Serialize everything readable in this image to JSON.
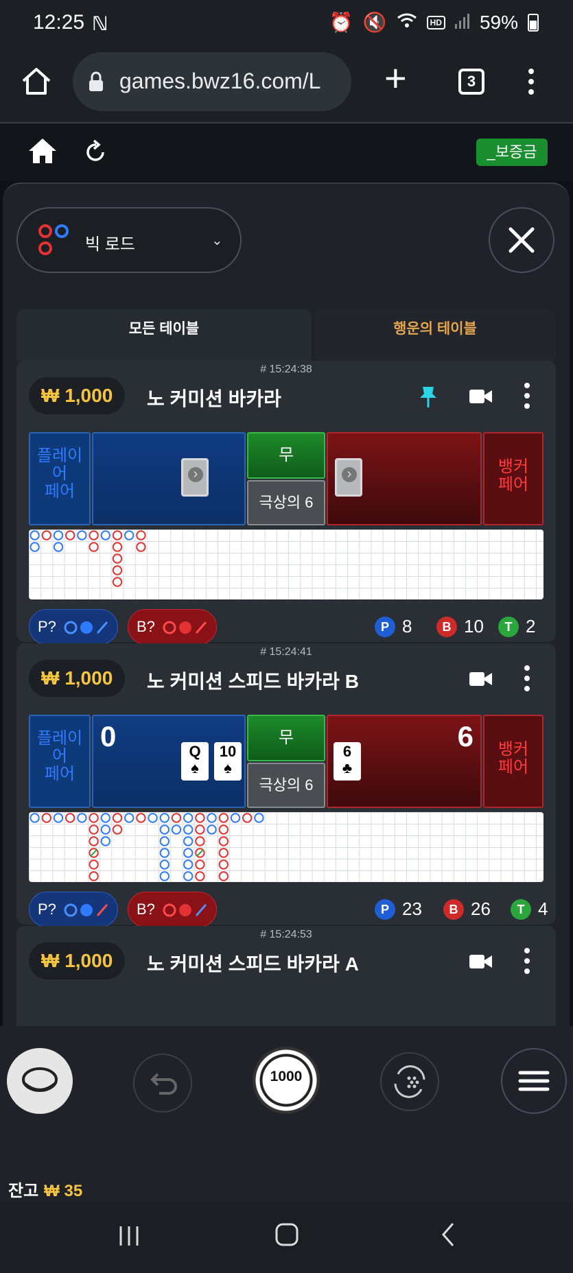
{
  "status": {
    "time": "12:25",
    "battery": "59%",
    "hd_label": "HD",
    "voice_label": "Voice"
  },
  "browser": {
    "url": "games.bwz16.com/L",
    "tab_count": "3"
  },
  "game_header": {
    "deposit_label": "_보증금"
  },
  "road_selector": {
    "label": "빅 로드"
  },
  "tabs": {
    "all": "모든 테이블",
    "lucky": "행운의 테이블"
  },
  "tables": [
    {
      "timestamp": "# 15:24:38",
      "amount": "₩ 1,000",
      "name": "노 커미션 바카라",
      "player_pair": "플레이어\n페어",
      "tie": "무",
      "super6": "극상의 6",
      "banker_pair": "뱅커\n페어",
      "ask_player": "P?",
      "ask_banker": "B?",
      "stats": {
        "p": "8",
        "b": "10",
        "t": "2"
      }
    },
    {
      "timestamp": "# 15:24:41",
      "amount": "₩ 1,000",
      "name": "노 커미션 스피드 바카라 B",
      "player_pair": "플레이어\n페어",
      "tie": "무",
      "super6": "극상의 6",
      "banker_pair": "뱅커\n페어",
      "player_score": "0",
      "banker_score": "6",
      "player_cards": [
        {
          "rank": "Q",
          "suit": "♠"
        },
        {
          "rank": "10",
          "suit": "♠"
        }
      ],
      "banker_cards": [
        {
          "rank": "6",
          "suit": "♣"
        }
      ],
      "ask_player": "P?",
      "ask_banker": "B?",
      "stats": {
        "p": "23",
        "b": "26",
        "t": "4"
      }
    },
    {
      "timestamp": "# 15:24:53",
      "amount": "₩ 1,000",
      "name": "노 커미션 스피드 바카라 A"
    }
  ],
  "stat_letters": {
    "p": "P",
    "b": "B",
    "t": "T"
  },
  "chip": {
    "value": "1000"
  },
  "balance": {
    "label": "잔고",
    "value": "₩ 35"
  },
  "colors": {
    "player": "#2f7bff",
    "banker": "#e23232",
    "tie": "#2aa63c",
    "gold": "#f5c542",
    "deposit": "#1a8f2f"
  },
  "road1": {
    "cols": [
      [
        "P",
        "P"
      ],
      [
        "B"
      ],
      [
        "P",
        "P"
      ],
      [
        "B"
      ],
      [
        "P"
      ],
      [
        "B",
        "T"
      ],
      [
        "P"
      ],
      [
        "B",
        "B",
        "B",
        "B",
        "B"
      ],
      [
        "P"
      ],
      [
        "B",
        "B"
      ]
    ],
    "first_ties": [
      0
    ]
  },
  "road2": {
    "cols": [
      [
        "P"
      ],
      [
        "B"
      ],
      [
        "P"
      ],
      [
        "B"
      ],
      [
        "P"
      ],
      [
        "B",
        "B",
        "B",
        "BT",
        "B",
        "B"
      ],
      [
        "P",
        "P",
        "P"
      ],
      [
        "B",
        "B"
      ],
      [
        "P"
      ],
      [
        "B"
      ],
      [
        "P"
      ],
      [
        "P",
        "P",
        "P",
        "P",
        "P",
        "P"
      ],
      [
        "B",
        "P"
      ],
      [
        "P",
        "P",
        "P",
        "P",
        "P",
        "P"
      ],
      [
        "B",
        "B",
        "B",
        "BT",
        "B",
        "B"
      ],
      [
        "P",
        "P"
      ],
      [
        "B",
        "B",
        "B",
        "B",
        "B",
        "B"
      ],
      [
        "P"
      ],
      [
        "B"
      ],
      [
        "P"
      ]
    ]
  }
}
